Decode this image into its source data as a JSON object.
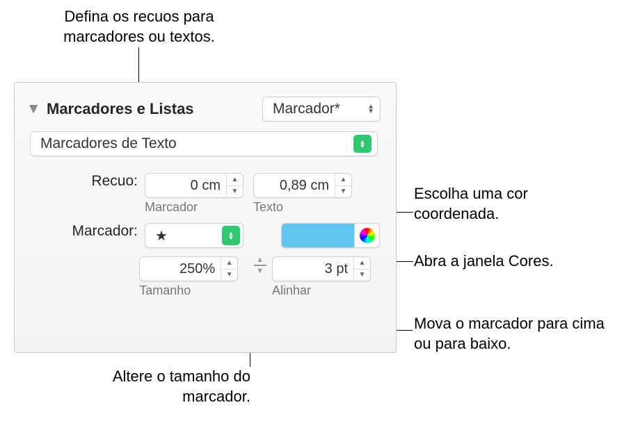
{
  "callouts": {
    "top": "Defina os recuos para marcadores ou textos.",
    "r1": "Escolha uma cor coordenada.",
    "r2": "Abra a janela Cores.",
    "r3": "Mova o marcador para cima ou para baixo.",
    "bottom": "Altere o tamanho do marcador."
  },
  "section": {
    "title": "Marcadores e Listas",
    "style_popup": "Marcador*",
    "type_popup": "Marcadores de Texto"
  },
  "indent": {
    "label": "Recuo:",
    "marker": {
      "value": "0 cm",
      "sublabel": "Marcador"
    },
    "text": {
      "value": "0,89 cm",
      "sublabel": "Texto"
    }
  },
  "marker": {
    "label": "Marcador:",
    "symbol": "★"
  },
  "size": {
    "value": "250%",
    "sublabel": "Tamanho"
  },
  "align": {
    "value": "3 pt",
    "sublabel": "Alinhar"
  }
}
